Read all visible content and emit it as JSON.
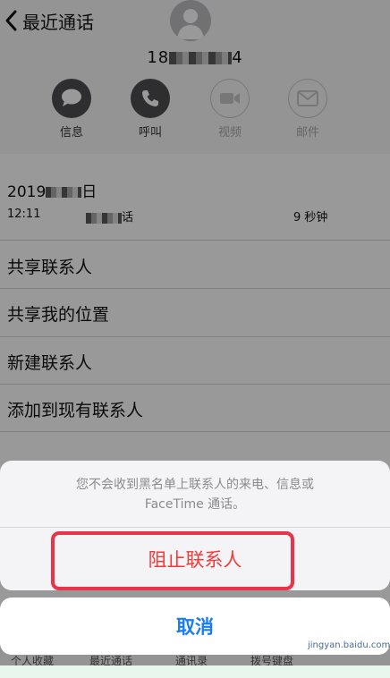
{
  "nav": {
    "back_label": "最近通话"
  },
  "contact": {
    "number_prefix": "18",
    "number_suffix": "4"
  },
  "actions": [
    {
      "label": "信息",
      "icon": "message-icon",
      "enabled": true
    },
    {
      "label": "呼叫",
      "icon": "phone-icon",
      "enabled": true
    },
    {
      "label": "视频",
      "icon": "video-icon",
      "enabled": false
    },
    {
      "label": "邮件",
      "icon": "mail-icon",
      "enabled": false
    }
  ],
  "call": {
    "date_prefix": "2019",
    "date_suffix": "日",
    "time": "12:11",
    "type_suffix": "话",
    "duration": "9 秒钟"
  },
  "menu": [
    {
      "label": "共享联系人"
    },
    {
      "label": "共享我的位置"
    },
    {
      "label": "新建联系人"
    },
    {
      "label": "添加到现有联系人"
    }
  ],
  "sheet": {
    "message_line1": "您不会收到黑名单上联系人的来电、信息或",
    "message_line2": "FaceTime 通话。",
    "block_label": "阻止联系人",
    "cancel_label": "取消"
  },
  "tabbar": [
    {
      "label": "个人收藏"
    },
    {
      "label": "最近通话"
    },
    {
      "label": "通讯录"
    },
    {
      "label": "拨号键盘"
    }
  ],
  "watermark": {
    "text": "jingyan.baidu.com"
  },
  "colors": {
    "destructive": "#f23b3b",
    "accent": "#1b7cf1",
    "highlight": "#e8344a"
  }
}
